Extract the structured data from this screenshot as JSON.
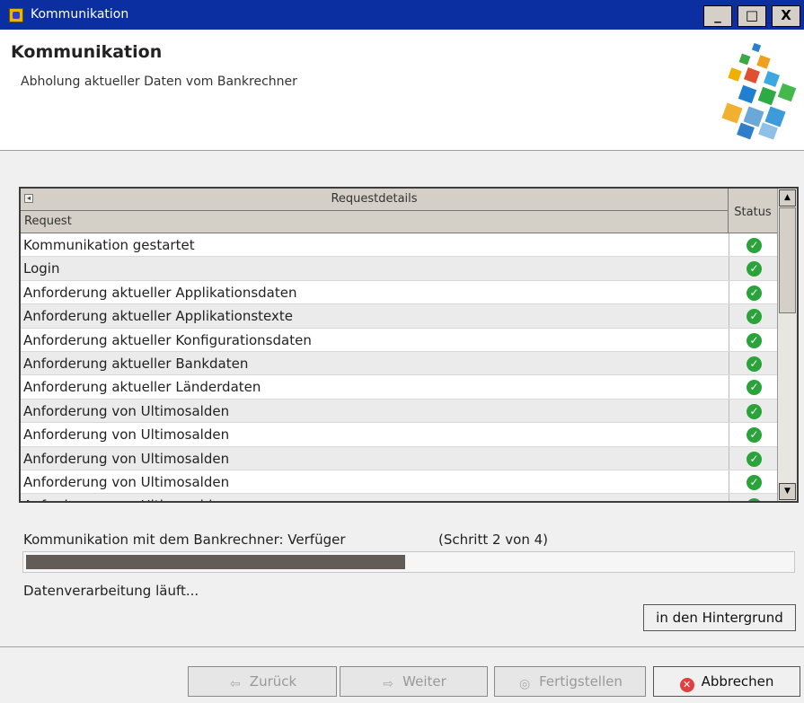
{
  "window": {
    "title": "Kommunikation",
    "controls": {
      "minimize": "_",
      "maximize": "□",
      "close": "X"
    }
  },
  "header": {
    "title": "Kommunikation",
    "subtitle": "Abholung aktueller Daten vom Bankrechner",
    "logo_icon": "colorful-cubes-logo"
  },
  "table": {
    "group_header": "Requestdetails",
    "col_request": "Request",
    "col_status": "Status",
    "rows": [
      {
        "request": "Kommunikation gestartet",
        "status": "ok"
      },
      {
        "request": "Login",
        "status": "ok"
      },
      {
        "request": "Anforderung aktueller Applikationsdaten",
        "status": "ok"
      },
      {
        "request": "Anforderung aktueller Applikationstexte",
        "status": "ok"
      },
      {
        "request": "Anforderung aktueller Konfigurationsdaten",
        "status": "ok"
      },
      {
        "request": "Anforderung aktueller Bankdaten",
        "status": "ok"
      },
      {
        "request": "Anforderung aktueller Länderdaten",
        "status": "ok"
      },
      {
        "request": "Anforderung von Ultimosalden",
        "status": "ok"
      },
      {
        "request": "Anforderung von Ultimosalden",
        "status": "ok"
      },
      {
        "request": "Anforderung von Ultimosalden",
        "status": "ok"
      },
      {
        "request": "Anforderung von Ultimosalden",
        "status": "ok"
      },
      {
        "request": "Anforderung von Ultimosalden",
        "status": "ok"
      }
    ]
  },
  "progress": {
    "label": "Kommunikation mit dem Bankrechner: Verfüger",
    "step": "(Schritt 2 von 4)",
    "fraction": 0.5,
    "status": "Datenverarbeitung läuft..."
  },
  "buttons": {
    "background": "in den Hintergrund",
    "back": "Zurück",
    "next": "Weiter",
    "finish": "Fertigstellen",
    "cancel": "Abbrechen"
  },
  "colors": {
    "titlebar": "#0b2ea0",
    "progress_fill": "#625c58",
    "status_ok": "#2aa33a",
    "cancel_icon": "#e04040"
  }
}
